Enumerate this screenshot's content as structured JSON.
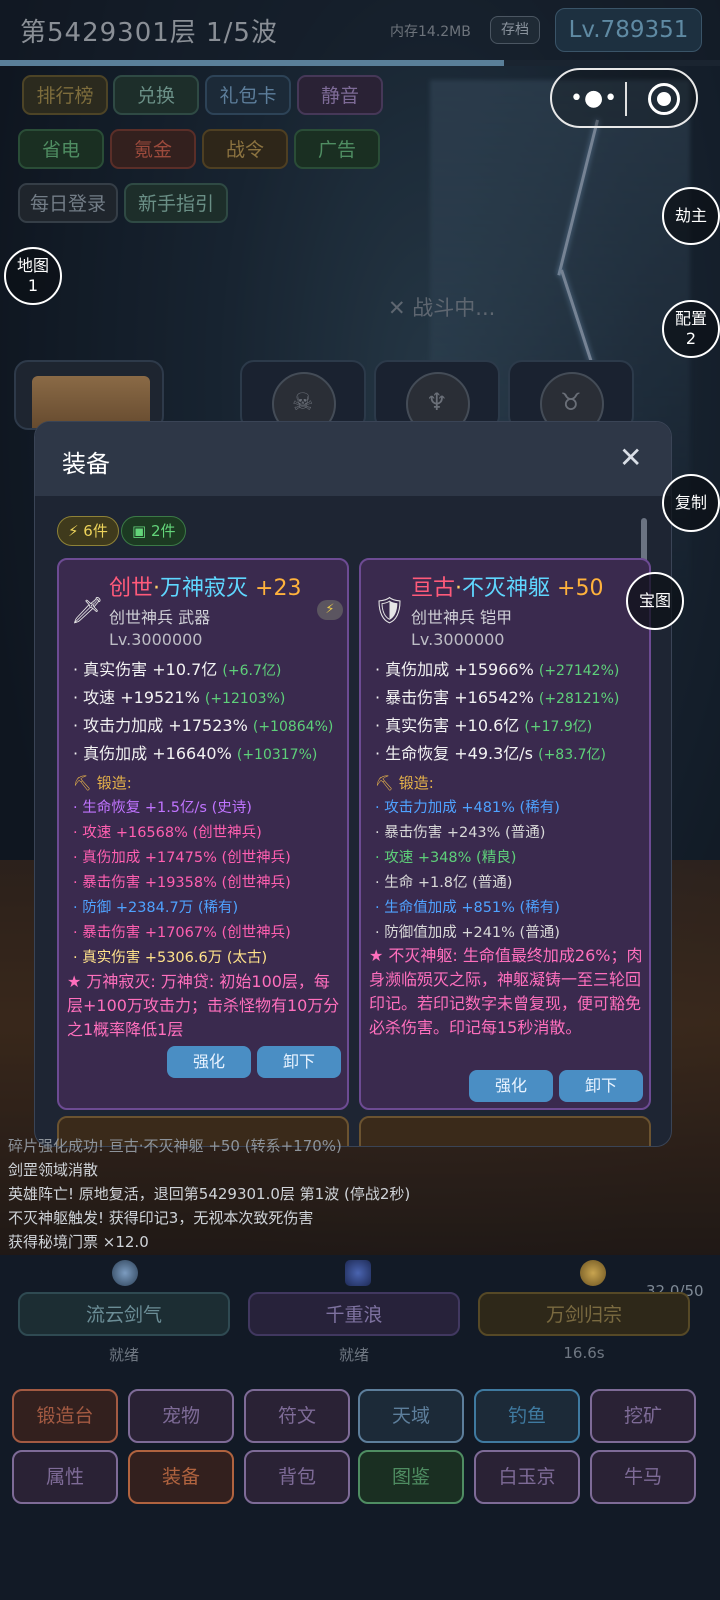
{
  "header": {
    "stage": "第5429301层  1/5波",
    "memory": "内存14.2MB",
    "save": "存档",
    "level": "Lv.789351",
    "progress": 0.7
  },
  "menu_rows": {
    "row1": [
      "排行榜",
      "兑换",
      "礼包卡",
      "静音"
    ],
    "row2": [
      "省电",
      "氪金",
      "战令",
      "广告"
    ],
    "row3": [
      "每日登录",
      "新手指引"
    ]
  },
  "side": {
    "map_label": "地图",
    "map_num": "1",
    "rob": "劫主",
    "config_label": "配置",
    "config_num": "2",
    "copy": "复制",
    "treasure": "宝图"
  },
  "fighting": "✕ 战斗中...",
  "modal": {
    "title": "装备",
    "close": "✕",
    "chips": [
      "⚡ 6件",
      "▣ 2件"
    ],
    "cards": [
      {
        "name_a": "创世",
        "dot": "·",
        "name_b": "万神寂灭",
        "plus": "+23",
        "sub": "创世神兵  武器",
        "lv": "Lv.3000000",
        "stats": [
          {
            "t": "· 真实伤害 +10.7亿 ",
            "inc": "(+6.7亿)"
          },
          {
            "t": "· 攻速 +19521% ",
            "inc": "(+12103%)"
          },
          {
            "t": "· 攻击力加成 +17523% ",
            "inc": "(+10864%)"
          },
          {
            "t": "· 真伤加成 +16640% ",
            "inc": "(+10317%)"
          }
        ],
        "forge": "⛏ 锻造:",
        "forges": [
          {
            "t": "· 生命恢复 +1.5亿/s (史诗)",
            "q": "epic"
          },
          {
            "t": "· 攻速 +16568% (创世神兵)",
            "q": "myth"
          },
          {
            "t": "· 真伤加成 +17475% (创世神兵)",
            "q": "myth"
          },
          {
            "t": "· 暴击伤害 +19358% (创世神兵)",
            "q": "myth"
          },
          {
            "t": "· 防御 +2384.7万 (稀有)",
            "q": "rare"
          },
          {
            "t": "· 暴击伤害 +17067% (创世神兵)",
            "q": "myth"
          },
          {
            "t": "· 真实伤害 +5306.6万 (太古)",
            "q": "ancient"
          }
        ],
        "desc": "★ 万神寂灭: 万神贷: 初始100层，每层+100万攻击力；击杀怪物有10万分之1概率降低1层",
        "enhance": "强化",
        "unequip": "卸下"
      },
      {
        "name_a": "亘古",
        "dot": "·",
        "name_b": "不灭神躯",
        "plus": "+50",
        "sub": "创世神兵  铠甲",
        "lv": "Lv.3000000",
        "stats": [
          {
            "t": "· 真伤加成 +15966% ",
            "inc": "(+27142%)"
          },
          {
            "t": "· 暴击伤害 +16542% ",
            "inc": "(+28121%)"
          },
          {
            "t": "· 真实伤害 +10.6亿 ",
            "inc": "(+17.9亿)"
          },
          {
            "t": "· 生命恢复 +49.3亿/s ",
            "inc": "(+83.7亿)"
          }
        ],
        "forge": "⛏ 锻造:",
        "forges": [
          {
            "t": "· 攻击力加成 +481% (稀有)",
            "q": "rare"
          },
          {
            "t": "· 暴击伤害 +243% (普通)",
            "q": "normal"
          },
          {
            "t": "· 攻速 +348% (精良)",
            "q": "fine"
          },
          {
            "t": "· 生命 +1.8亿 (普通)",
            "q": "normal"
          },
          {
            "t": "· 生命值加成 +851% (稀有)",
            "q": "rare"
          },
          {
            "t": "· 防御值加成 +241% (普通)",
            "q": "normal"
          }
        ],
        "desc": "★ 不灭神躯: 生命值最终加成26%；肉身濒临殒灭之际，神躯凝铸一至三轮回印记。若印记数字未曾复现，便可豁免必杀伤害。印记每15秒消散。",
        "enhance": "强化",
        "unequip": "卸下"
      }
    ]
  },
  "log": [
    "碎片强化成功! 亘古·不灭神躯 +50 (转系+170%)",
    "剑罡领域消散",
    "英雄阵亡! 原地复活，退回第5429301.0层 第1波 (停战2秒)",
    "不灭神躯触发! 获得印记3，无视本次致死伤害",
    "获得秘境门票 ×12.0"
  ],
  "energy": "32.0/50",
  "skills": [
    {
      "name": "流云剑气",
      "status": "就绪"
    },
    {
      "name": "千重浪",
      "status": "就绪"
    },
    {
      "name": "万剑归宗",
      "status": "16.6s"
    }
  ],
  "grid_row1": [
    "锻造台",
    "宠物",
    "符文",
    "天域",
    "钓鱼",
    "挖矿"
  ],
  "grid_row2": [
    "属性",
    "装备",
    "背包",
    "图鉴",
    "白玉京",
    "牛马"
  ]
}
